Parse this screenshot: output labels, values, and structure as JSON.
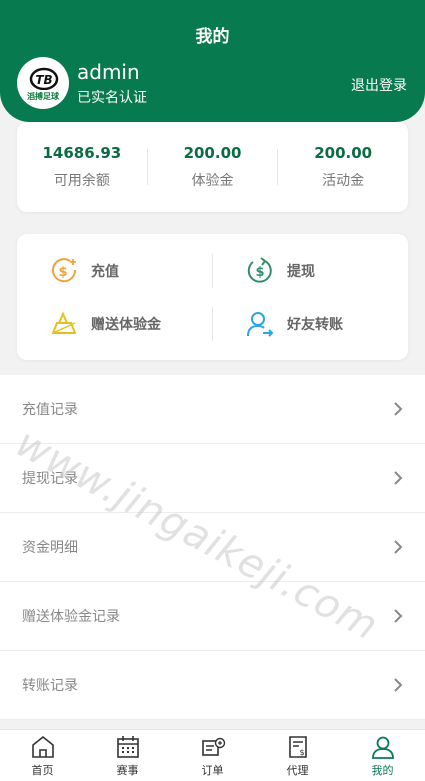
{
  "header": {
    "title": "我的",
    "logout": "退出登录"
  },
  "user": {
    "name": "admin",
    "verify_status": "已实名认证",
    "logo_text": "TB",
    "logo_caption": "滔搏足球"
  },
  "balances": [
    {
      "value": "14686.93",
      "label": "可用余额"
    },
    {
      "value": "200.00",
      "label": "体验金"
    },
    {
      "value": "200.00",
      "label": "活动金"
    }
  ],
  "actions": [
    {
      "label": "充值",
      "icon": "recharge-icon"
    },
    {
      "label": "提现",
      "icon": "withdraw-icon"
    },
    {
      "label": "赠送体验金",
      "icon": "gift-icon"
    },
    {
      "label": "好友转账",
      "icon": "transfer-icon"
    }
  ],
  "menu": [
    {
      "label": "充值记录"
    },
    {
      "label": "提现记录"
    },
    {
      "label": "资金明细"
    },
    {
      "label": "赠送体验金记录"
    },
    {
      "label": "转账记录"
    }
  ],
  "watermark": "www.jingaikeji.com",
  "tabs": [
    {
      "label": "首页",
      "icon": "home-icon"
    },
    {
      "label": "赛事",
      "icon": "calendar-icon"
    },
    {
      "label": "订单",
      "icon": "order-icon"
    },
    {
      "label": "代理",
      "icon": "agent-icon"
    },
    {
      "label": "我的",
      "icon": "user-icon",
      "active": true
    }
  ],
  "colors": {
    "brand": "#087a4f",
    "balance_value": "#0b6b43",
    "recharge": "#f3a23a",
    "withdraw": "#2f8f68",
    "gift": "#e6c020",
    "transfer": "#2aa7e0"
  }
}
